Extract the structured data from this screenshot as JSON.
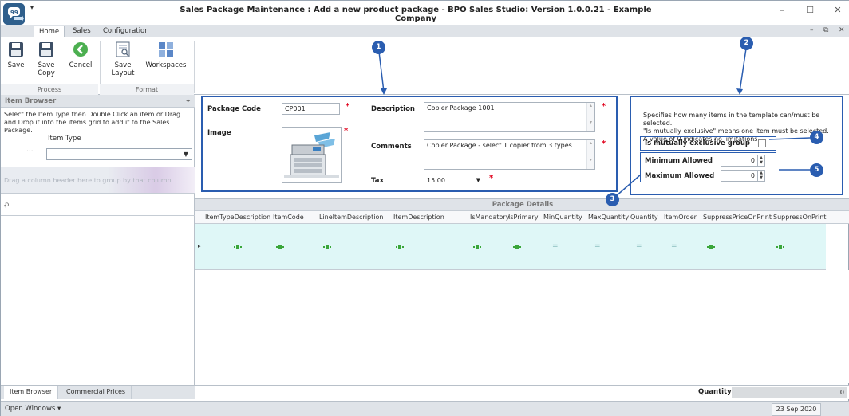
{
  "window": {
    "title": "Sales Package Maintenance : Add a new product package - BPO Sales Studio: Version 1.0.0.21 - Example Company",
    "qat_arrow": "▾",
    "minimize": "–",
    "maximize": "☐",
    "close": "✕"
  },
  "ribbon_tabs": [
    "Home",
    "Sales",
    "Configuration"
  ],
  "mdi_controls": {
    "minimize": "–",
    "restore": "⧉",
    "close": "✕"
  },
  "ribbon": {
    "save": "Save",
    "save_copy": "Save Copy",
    "cancel": "Cancel",
    "save_layout": "Save Layout",
    "workspaces": "Workspaces",
    "group_process": "Process",
    "group_format": "Format"
  },
  "item_browser": {
    "title": "Item Browser",
    "pin": "⌖",
    "help": "Select the Item Type then Double Click an item or Drag and Drop it into the items grid to add it to the Sales Package.",
    "item_type_label": "Item Type",
    "dots": "...",
    "item_type_value": "",
    "group_hint": "Drag a column header here to group by that column",
    "filter_icon": "ꝓ"
  },
  "left_tabs": [
    "Item Browser",
    "Commercial Prices"
  ],
  "form": {
    "package_code_label": "Package Code",
    "package_code": "CP001",
    "image_label": "Image",
    "description_label": "Description",
    "description": "Copier Package 1001",
    "comments_label": "Comments",
    "comments": "Copier Package - select 1 copier from 3 types",
    "tax_label": "Tax",
    "tax": "15.00",
    "required_mark": "*"
  },
  "selection_rules": {
    "info_line1": "Specifies how many items in the template can/must be selected.",
    "info_line2": "\"Is mutually exclusive\" means one item must be selected.",
    "info_line3": "A value of 0 indicates no limitations.",
    "mutually_exclusive_label": "Is mutually exclusive group",
    "mutually_exclusive_checked": false,
    "min_label": "Minimum Allowed",
    "min_value": "0",
    "max_label": "Maximum Allowed",
    "max_value": "0"
  },
  "callouts": [
    "1",
    "2",
    "3",
    "4",
    "5"
  ],
  "package_details": {
    "title": "Package Details",
    "columns": [
      "ItemTypeDescription",
      "ItemCode",
      "LineItemDescription",
      "ItemDescription",
      "IsMandatory",
      "IsPrimary",
      "MinQuantity",
      "MaxQuantity",
      "Quantity",
      "ItemOrder",
      "SuppressPriceOnPrint",
      "SuppressOnPrint"
    ],
    "new_row_marker": "▸",
    "dash": "="
  },
  "footer": {
    "quantity_label": "Quantity",
    "quantity_value": "0"
  },
  "status_bar": {
    "open_windows": "Open Windows ▾",
    "date": "23 Sep 2020"
  },
  "colors": {
    "highlight": "#2a5db0",
    "required": "#e0001b",
    "new_row_bg": "#dff7f7"
  }
}
